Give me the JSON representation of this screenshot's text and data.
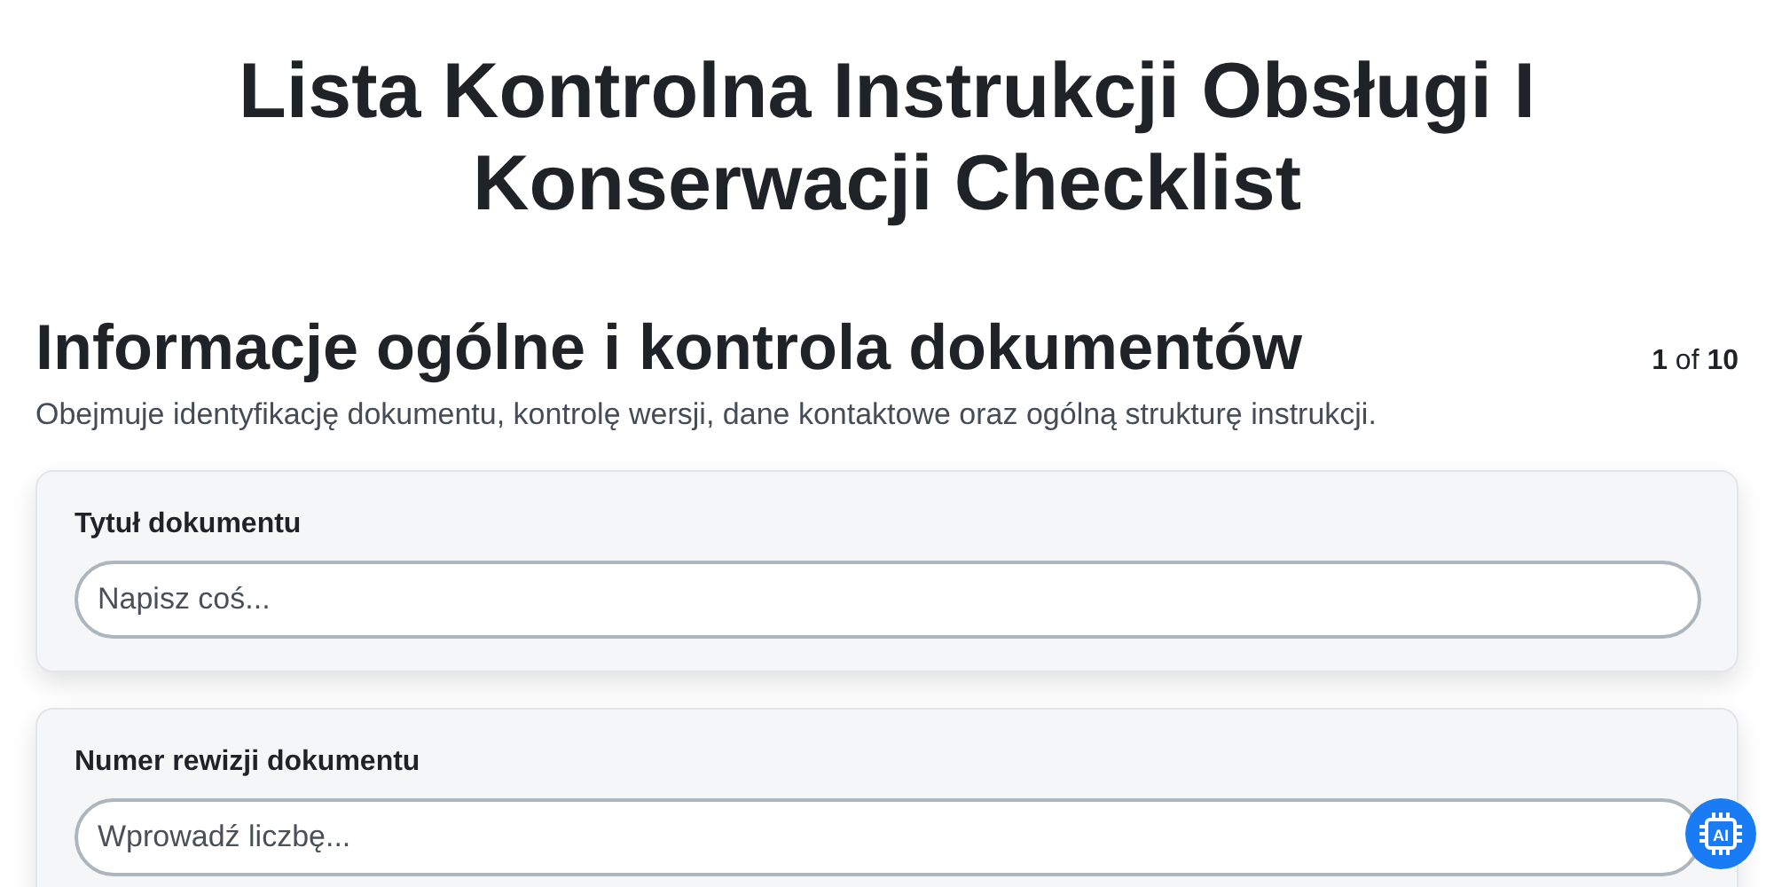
{
  "title": "Lista Kontrolna Instrukcji Obsługi I Konserwacji Checklist",
  "section": {
    "heading": "Informacje ogólne i kontrola dokumentów",
    "counter": "**1** of **10**",
    "description": "Obejmuje identyfikację dokumentu, kontrolę wersji, dane kontaktowe oraz ogólną strukturę instrukcji."
  },
  "questions": [
    {
      "label": "Tytuł dokumentu",
      "placeholder": "Napisz coś..."
    },
    {
      "label": "Numer rewizji dokumentu",
      "placeholder": "Wprowadź liczbę..."
    }
  ],
  "ai_button": {
    "label": "AI"
  }
}
